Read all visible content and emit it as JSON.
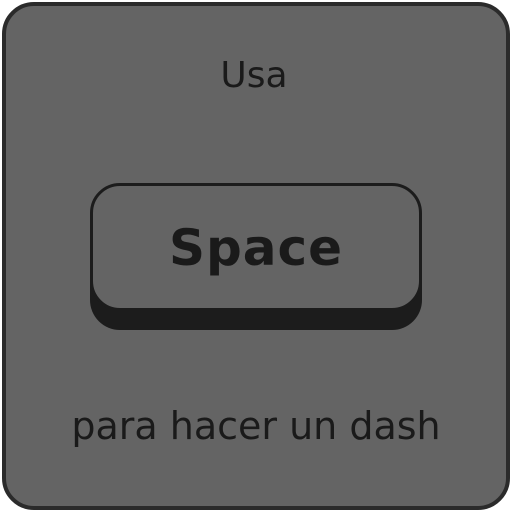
{
  "prompt": {
    "top_text": "Usa",
    "key_label": "Space",
    "bottom_text": "para hacer un dash"
  },
  "colors": {
    "panel_fill": "#646464",
    "panel_border": "#2b2b2b",
    "text": "#1a1a1a",
    "key_outline": "#1c1c1c"
  }
}
